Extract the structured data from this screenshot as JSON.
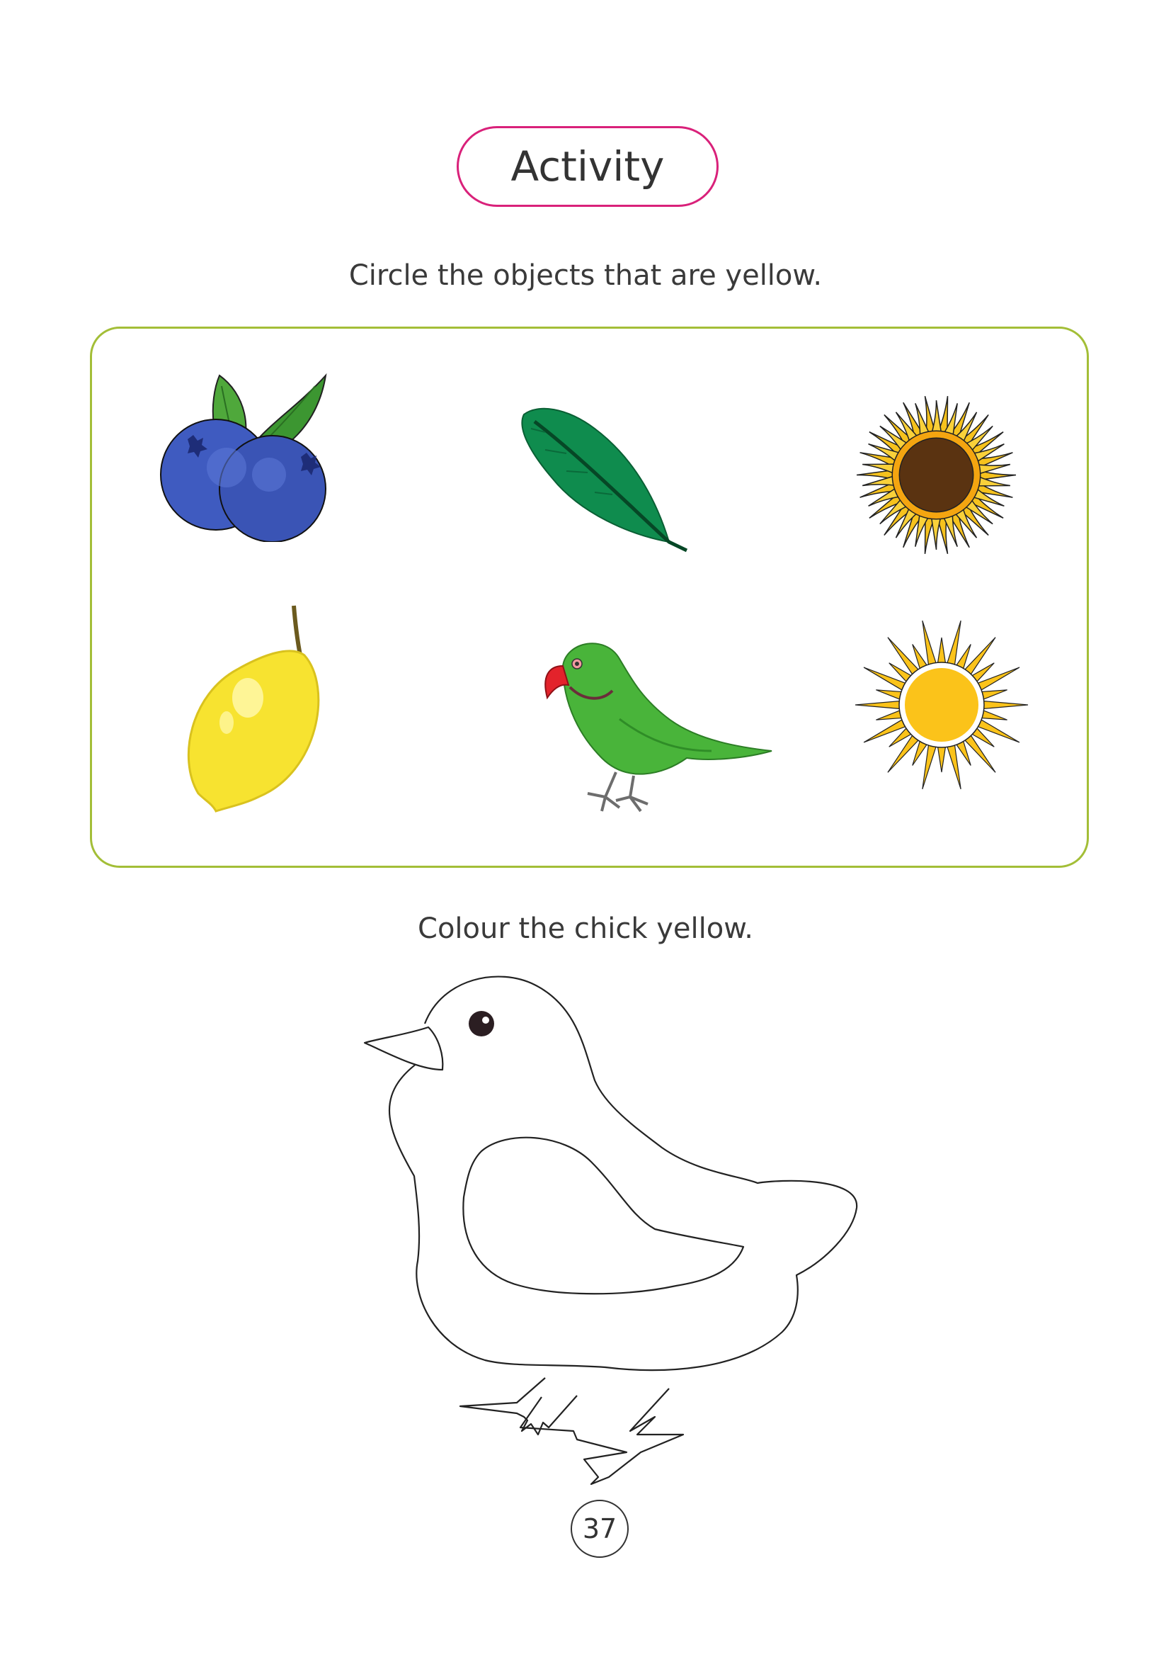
{
  "header": {
    "title": "Activity"
  },
  "task1": {
    "instruction": "Circle the objects that are yellow.",
    "items": [
      {
        "name": "blueberries",
        "colour": "#3f5bc0"
      },
      {
        "name": "leaf",
        "colour": "#0f8c4e"
      },
      {
        "name": "sunflower",
        "colour": "#f6c21d"
      },
      {
        "name": "lemon",
        "colour": "#f7e330"
      },
      {
        "name": "parrot",
        "colour": "#49b43a"
      },
      {
        "name": "sun",
        "colour": "#fbc31a"
      }
    ],
    "frame_colour": "#a3be37"
  },
  "task2": {
    "instruction": "Colour the chick yellow."
  },
  "footer": {
    "page_number": "37"
  },
  "accent_colour": "#d9217a"
}
